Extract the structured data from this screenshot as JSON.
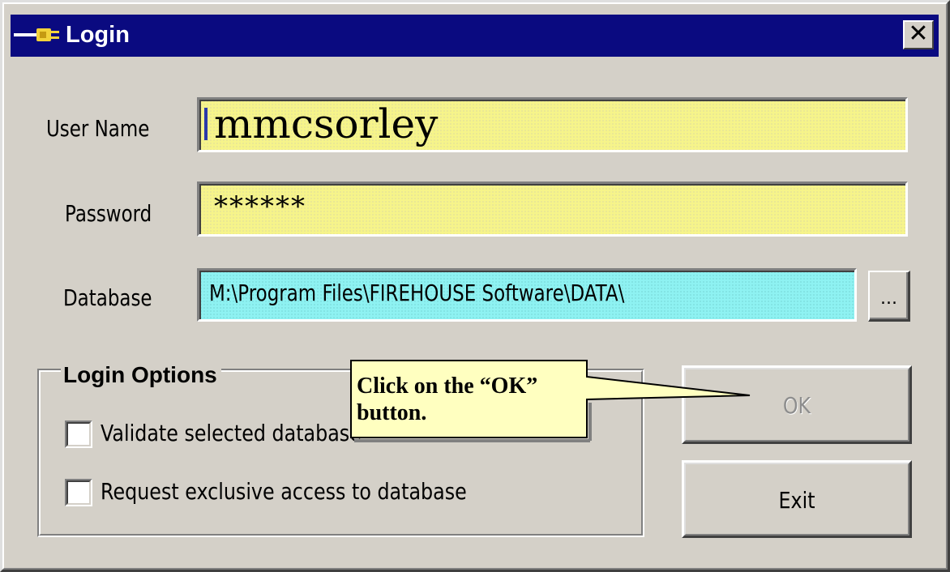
{
  "window": {
    "title": "Login",
    "close_label": "✕"
  },
  "form": {
    "user_name_label": "User Name",
    "user_name_value": "mmcsorley",
    "password_label": "Password",
    "password_value": "******",
    "database_label": "Database",
    "database_value": "M:\\Program Files\\FIREHOUSE Software\\DATA\\",
    "browse_label": "..."
  },
  "login_options": {
    "title": "Login Options",
    "validate_label": "Validate selected database",
    "exclusive_label": "Request exclusive access to database"
  },
  "buttons": {
    "ok_label": "OK",
    "exit_label": "Exit"
  },
  "callout": {
    "text": "Click on the “OK” button."
  },
  "colors": {
    "titlebar": "#0a0a80",
    "input_highlight": "#f6f48a",
    "database_field": "#8ef2f2",
    "callout_bg": "#ffffc0"
  },
  "icons": {
    "title_icon": "key-plug-icon"
  }
}
